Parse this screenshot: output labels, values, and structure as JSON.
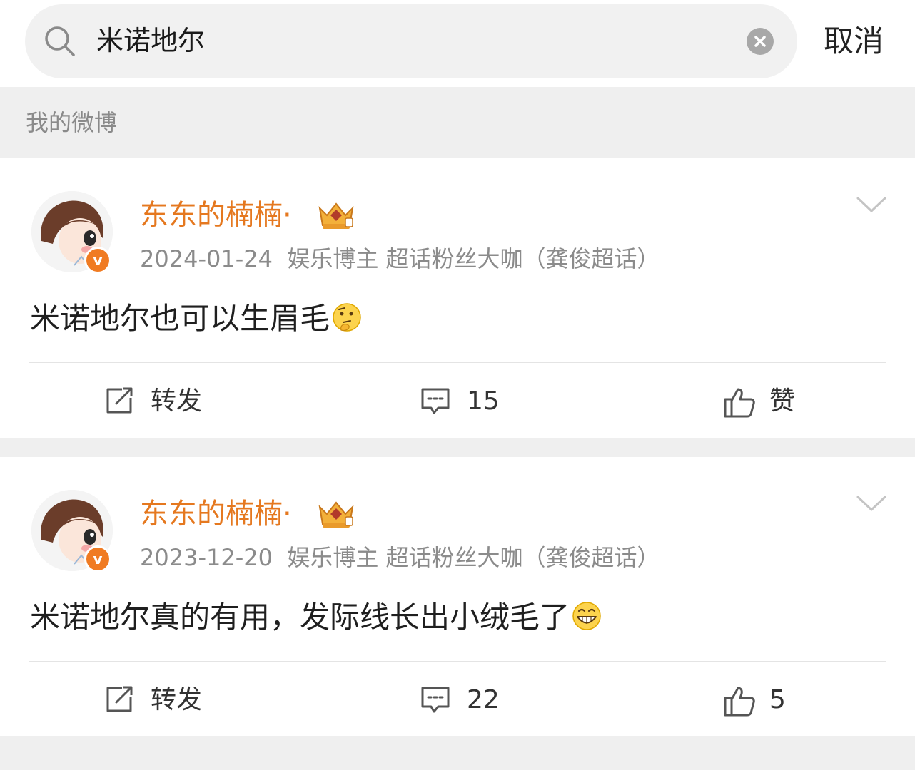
{
  "search": {
    "query": "米诺地尔",
    "cancel_label": "取消",
    "icon": "search-icon",
    "clear_icon": "clear-icon"
  },
  "section": {
    "label": "我的微博"
  },
  "accent_color": "#e5781f",
  "posts": [
    {
      "username": "东东的楠楠·",
      "date": "2024-01-24",
      "tags": "娱乐博主 超话粉丝大咖（龚俊超话）",
      "content": "米诺地尔也可以生眉毛",
      "emoji": "thinking-face",
      "actions": {
        "repost_label": "转发",
        "comments": "15",
        "likes_label": "赞"
      }
    },
    {
      "username": "东东的楠楠·",
      "date": "2023-12-20",
      "tags": "娱乐博主 超话粉丝大咖（龚俊超话）",
      "content": "米诺地尔真的有用，发际线长出小绒毛了",
      "emoji": "grinning-face",
      "actions": {
        "repost_label": "转发",
        "comments": "22",
        "likes_label": "5"
      }
    }
  ]
}
